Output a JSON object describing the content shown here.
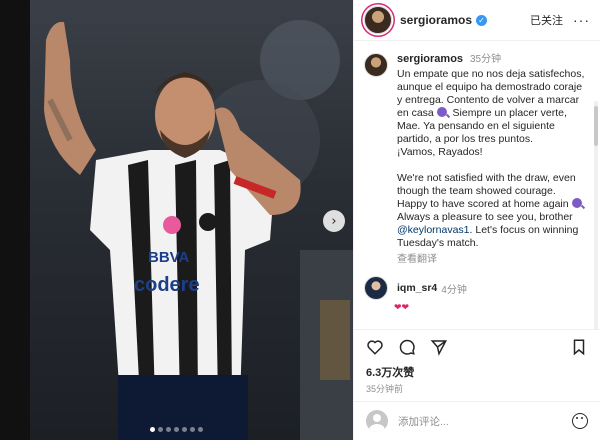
{
  "author": {
    "username": "sergioramos",
    "follow_status": "已关注",
    "more": "···"
  },
  "caption": {
    "username": "sergioramos",
    "time": "35分钟",
    "spanish": [
      "Un empate que no nos deja satisfechos, aunque el equipo ha demostrado coraje y entrega.",
      "Contento de volver a marcar en casa",
      ". Siempre un placer verte, Mae.",
      "Ya pensando en el siguiente partido, a por los tres puntos.",
      "¡Vamos, Rayados!"
    ],
    "english": [
      "We're not satisfied with the draw, even though the team showed courage. Happy to have scored at home again",
      ". Always a pleasure to see you, brother ",
      "@keylornavas1",
      ".",
      "Let's focus on winning Tuesday's match."
    ],
    "translate": "查看翻译"
  },
  "comment": {
    "username": "iqm_sr4",
    "time": "4分钟",
    "emoji": "❤❤"
  },
  "likes": "6.3万次赞",
  "posted_ago": "35分钟前",
  "add_comment": {
    "placeholder": "添加评论..."
  },
  "photo": {
    "jersey_sponsor": "codere",
    "jersey_bank": "BBVA"
  },
  "colors": {
    "accent": "#3897f0",
    "mention": "#00376b"
  }
}
